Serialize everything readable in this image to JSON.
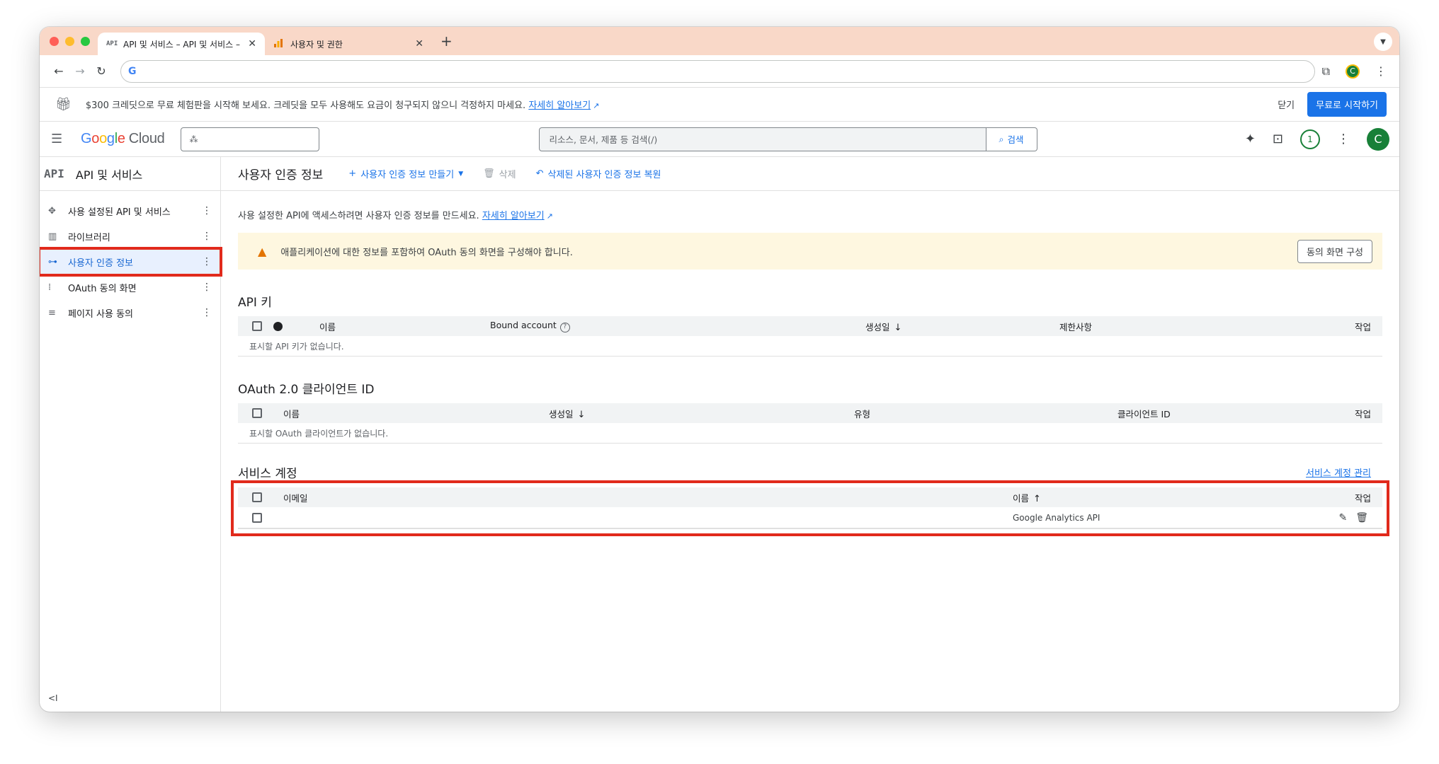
{
  "browser": {
    "tabs": [
      {
        "icon": "API",
        "title": "API 및 서비스 – API 및 서비스 – [",
        "active": true
      },
      {
        "icon": "analytics-icon",
        "title": "사용자 및 권한",
        "active": false
      }
    ],
    "address_value": ""
  },
  "promo": {
    "text": "$300 크레딧으로 무료 체험판을 시작해 보세요. 크레딧을 모두 사용해도 요금이 청구되지 않으니 걱정하지 마세요.",
    "link": "자세히 알아보기",
    "close": "닫기",
    "start": "무료로 시작하기"
  },
  "header": {
    "logo_google": [
      "G",
      "o",
      "o",
      "g",
      "l",
      "e"
    ],
    "logo_cloud": "Cloud",
    "search_placeholder": "리소스, 문서, 제품 등 검색(/)",
    "search_button": "검색",
    "notifications": "1",
    "avatar": "C"
  },
  "sidebar": {
    "badge": "API",
    "title": "API 및 서비스",
    "items": [
      {
        "icon": "enabled-apis-icon",
        "label": "사용 설정된 API 및 서비스"
      },
      {
        "icon": "library-icon",
        "label": "라이브러리"
      },
      {
        "icon": "key-icon",
        "label": "사용자 인증 정보"
      },
      {
        "icon": "consent-icon",
        "label": "OAuth 동의 화면"
      },
      {
        "icon": "page-usage-icon",
        "label": "페이지 사용 동의"
      }
    ],
    "active_index": 2,
    "collapse": "<I"
  },
  "content": {
    "page_title": "사용자 인증 정보",
    "actions": {
      "create": "사용자 인증 정보 만들기",
      "delete": "삭제",
      "restore": "삭제된 사용자 인증 정보 복원"
    },
    "intro": "사용 설정한 API에 액세스하려면 사용자 인증 정보를 만드세요.",
    "intro_link": "자세히 알아보기",
    "warning": {
      "text": "애플리케이션에 대한 정보를 포함하여 OAuth 동의 화면을 구성해야 합니다.",
      "button": "동의 화면 구성"
    },
    "api_keys": {
      "title": "API 키",
      "columns": {
        "name": "이름",
        "bound": "Bound account",
        "created": "생성일",
        "restrictions": "제한사항",
        "actions": "작업"
      },
      "empty": "표시할 API 키가 없습니다."
    },
    "oauth": {
      "title": "OAuth 2.0 클라이언트 ID",
      "columns": {
        "name": "이름",
        "created": "생성일",
        "type": "유형",
        "client_id": "클라이언트 ID",
        "actions": "작업"
      },
      "empty": "표시할 OAuth 클라이언트가 없습니다."
    },
    "service_accounts": {
      "title": "서비스 계정",
      "manage_link": "서비스 계정 관리",
      "columns": {
        "email": "이메일",
        "name": "이름",
        "actions": "작업"
      },
      "rows": [
        {
          "email": "",
          "name": "Google Analytics API"
        }
      ]
    }
  },
  "colors": {
    "accent": "#1a73e8",
    "highlight": "#e12a1c",
    "warning_bg": "#fef7e0",
    "tab_bar": "#f9d8c8"
  }
}
